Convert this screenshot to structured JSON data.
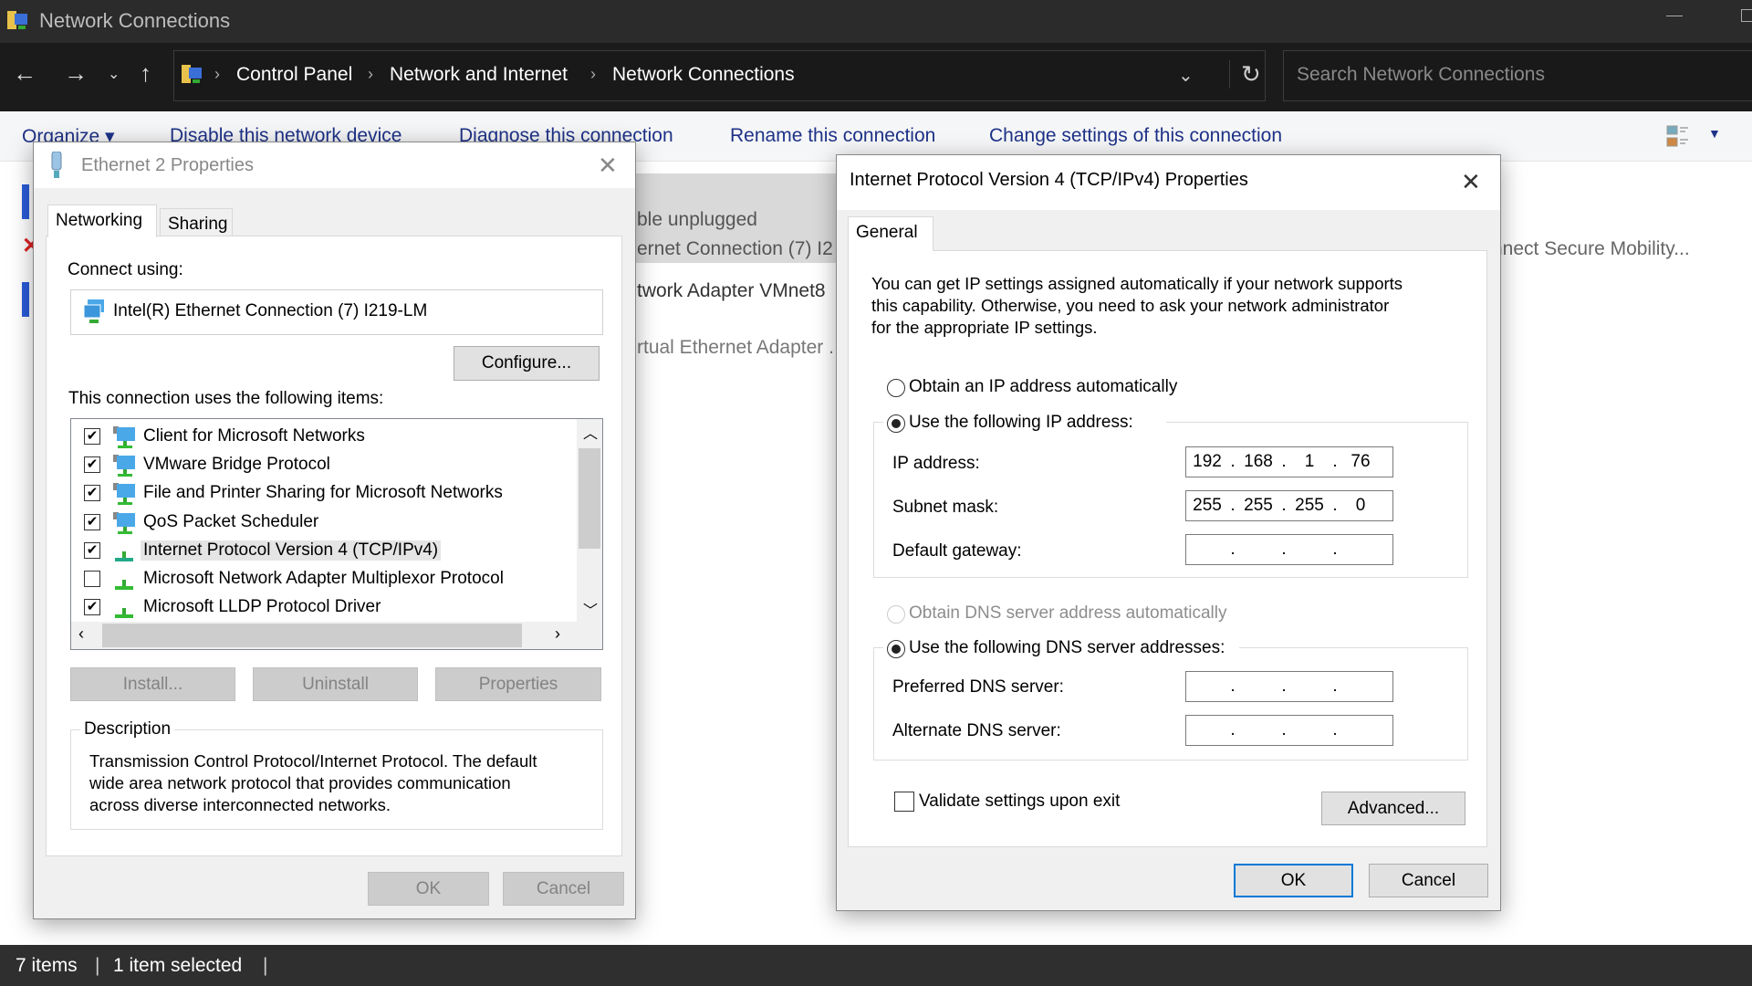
{
  "window": {
    "title": "Network Connections",
    "minimize_icon": "minimize-icon",
    "maximize_icon": "maximize-icon"
  },
  "address_bar": {
    "breadcrumbs": [
      "Control Panel",
      "Network and Internet",
      "Network Connections"
    ],
    "search_placeholder": "Search Network Connections"
  },
  "toolbar": {
    "organize": "Organize ▾",
    "disable": "Disable this network device",
    "diagnose": "Diagnose this connection",
    "rename": "Rename this connection",
    "change": "Change settings of this connection"
  },
  "background_items": {
    "status1": "ble unplugged",
    "device1": "ernet Connection (7) I2",
    "name2": "twork Adapter VMnet8",
    "device3": "rtual Ethernet Adapter .",
    "name4": "nnect Secure Mobility..."
  },
  "status_bar": {
    "count": "7 items",
    "selected": "1 item selected"
  },
  "ethernet_dialog": {
    "title": "Ethernet 2 Properties",
    "tabs": [
      "Networking",
      "Sharing"
    ],
    "connect_using_label": "Connect using:",
    "adapter": "Intel(R) Ethernet Connection (7) I219-LM",
    "configure": "Configure...",
    "items_label": "This connection uses the following items:",
    "items": [
      {
        "label": "Client for Microsoft Networks",
        "checked": true,
        "icon": "network-client-icon"
      },
      {
        "label": "VMware Bridge Protocol",
        "checked": true,
        "icon": "network-service-icon"
      },
      {
        "label": "File and Printer Sharing for Microsoft Networks",
        "checked": true,
        "icon": "network-service-icon"
      },
      {
        "label": "QoS Packet Scheduler",
        "checked": true,
        "icon": "network-service-icon"
      },
      {
        "label": "Internet Protocol Version 4 (TCP/IPv4)",
        "checked": true,
        "icon": "protocol-icon",
        "selected": true
      },
      {
        "label": "Microsoft Network Adapter Multiplexor Protocol",
        "checked": false,
        "icon": "protocol-icon"
      },
      {
        "label": "Microsoft LLDP Protocol Driver",
        "checked": true,
        "icon": "protocol-icon"
      }
    ],
    "install": "Install...",
    "uninstall": "Uninstall",
    "properties": "Properties",
    "description_label": "Description",
    "description_lines": [
      "Transmission Control Protocol/Internet Protocol. The default",
      "wide area network protocol that provides communication",
      "across diverse interconnected networks."
    ],
    "ok": "OK",
    "cancel": "Cancel"
  },
  "ipv4_dialog": {
    "title": "Internet Protocol Version 4 (TCP/IPv4) Properties",
    "tab": "General",
    "intro_lines": [
      "You can get IP settings assigned automatically if your network supports",
      "this capability. Otherwise, you need to ask your network administrator",
      "for the appropriate IP settings."
    ],
    "obtain_ip_auto": "Obtain an IP address automatically",
    "use_ip": "Use the following IP address:",
    "ip_label": "IP address:",
    "ip_value": [
      "192",
      "168",
      "1",
      "76"
    ],
    "subnet_label": "Subnet mask:",
    "subnet_value": [
      "255",
      "255",
      "255",
      "0"
    ],
    "gateway_label": "Default gateway:",
    "gateway_value": [
      "",
      "",
      "",
      ""
    ],
    "obtain_dns_auto": "Obtain DNS server address automatically",
    "use_dns": "Use the following DNS server addresses:",
    "preferred_label": "Preferred DNS server:",
    "preferred_value": [
      "",
      "",
      "",
      ""
    ],
    "alternate_label": "Alternate DNS server:",
    "alternate_value": [
      "",
      "",
      "",
      ""
    ],
    "ip_mode": "manual",
    "dns_mode": "manual",
    "validate": "Validate settings upon exit",
    "validate_checked": false,
    "advanced": "Advanced...",
    "ok": "OK",
    "cancel": "Cancel"
  },
  "colors": {
    "accent": "#0078d7",
    "titlebar": "#2b2b2b",
    "addressbar": "#1b1b1b",
    "toolbar_link": "#1e3287"
  }
}
